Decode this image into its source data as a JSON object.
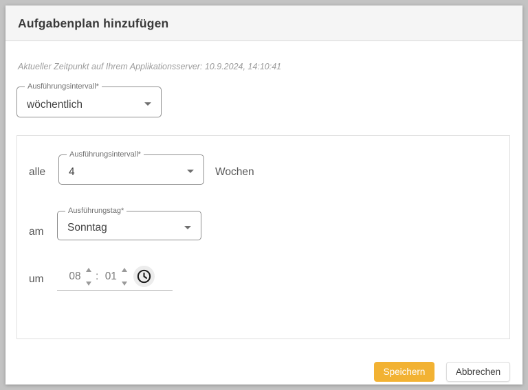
{
  "dialog": {
    "title": "Aufgabenplan hinzufügen",
    "server_time_note": "Aktueller Zeitpunkt auf Ihrem Applikationsserver: 10.9.2024, 14:10:41"
  },
  "interval_select": {
    "label": "Ausführungsintervall*",
    "value": "wöchentlich"
  },
  "weekly_panel": {
    "every_row": {
      "prefix": "alle",
      "select_label": "Ausführungsintervall*",
      "select_value": "4",
      "suffix": "Wochen"
    },
    "day_row": {
      "prefix": "am",
      "select_label": "Ausführungstag*",
      "select_value": "Sonntag"
    },
    "time_row": {
      "prefix": "um",
      "hours": "08",
      "separator": ":",
      "minutes": "01",
      "clock_icon": "clock-icon"
    }
  },
  "actions": {
    "save": "Speichern",
    "cancel": "Abbrechen"
  },
  "colors": {
    "accent": "#f2b233",
    "header_bg": "#f5f5f5",
    "page_bg": "#c3c3c3"
  }
}
